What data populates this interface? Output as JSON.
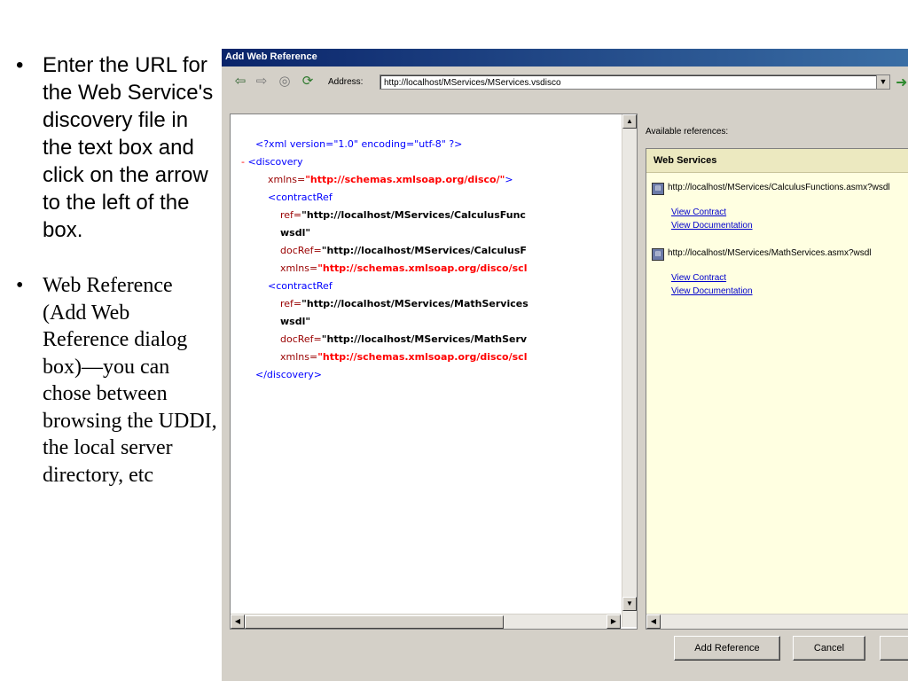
{
  "slide": {
    "bullet_symbol": "•",
    "bullets": [
      "Enter the URL for the Web Service's discovery file in the text box and click on the arrow to the left of the box.",
      "Web Reference (Add Web Reference dialog box)—you can chose between browsing the UDDI, the local server directory, etc"
    ]
  },
  "dialog": {
    "title": "Add Web Reference",
    "address_label": "Address:",
    "address_value": "http://localhost/MServices/MServices.vsdisco",
    "xml": {
      "pi": "<?xml version=\"1.0\" encoding=\"utf-8\" ?>",
      "discovery_open": "<discovery",
      "xmlns_attr": "xmlns=",
      "xmlns_value": "\"http://schemas.xmlsoap.org/disco/\"",
      "contract_ref": "<contractRef",
      "ref_attr": "ref=",
      "ref1_value": "\"http://localhost/MServices/CalculusFunc",
      "wsdl": "wsdl\"",
      "docref_attr": "docRef=",
      "docref1_value": "\"http://localhost/MServices/CalculusF",
      "xmlns_sc_value": "\"http://schemas.xmlsoap.org/disco/scl",
      "ref2_value": "\"http://localhost/MServices/MathServices",
      "docref2_value": "\"http://localhost/MServices/MathServ",
      "discovery_close": "</discovery>"
    },
    "available_label": "Available references:",
    "web_services_header": "Web Services",
    "services": [
      {
        "url": "http://localhost/MServices/CalculusFunctions.asmx?wsdl",
        "view_contract": "View Contract",
        "view_doc": "View Documentation"
      },
      {
        "url": "http://localhost/MServices/MathServices.asmx?wsdl",
        "view_contract": "View Contract",
        "view_doc": "View Documentation"
      }
    ],
    "buttons": {
      "add_reference": "Add Reference",
      "cancel": "Cancel"
    }
  },
  "colors": {
    "titlebar": "#0a246a",
    "dialog_bg": "#d4d0c8",
    "right_pane_bg": "#ffffe1",
    "link": "#0000cc",
    "xml_tag": "#990000",
    "xml_value": "#ff0000"
  },
  "icons": [
    "back-arrow-icon",
    "forward-arrow-icon",
    "stop-icon",
    "refresh-icon",
    "go-arrow-icon",
    "web-service-icon"
  ]
}
